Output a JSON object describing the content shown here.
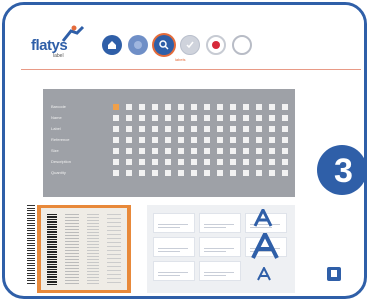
{
  "header": {
    "logo_text": "flatys",
    "logo_sub": "label",
    "toolbar_active_label": "labels",
    "toolbar_icons": [
      "home-icon",
      "circle-icon",
      "search-icon",
      "check-icon",
      "record-icon",
      "stop-icon"
    ]
  },
  "panel": {
    "rows": [
      "Barcode",
      "Name",
      "Label",
      "Reference",
      "Size",
      "Description",
      "Quantity"
    ],
    "checked": [
      [
        0
      ]
    ]
  },
  "step_badge": "3",
  "colors": {
    "brand_blue": "#2f5fa8",
    "accent_orange": "#e8893a",
    "panel_grey": "#9ea1a7",
    "record_red": "#d6293a"
  }
}
